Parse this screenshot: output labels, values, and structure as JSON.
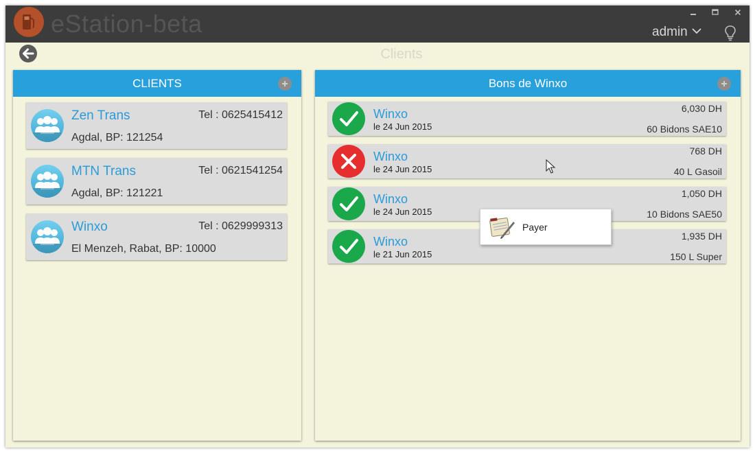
{
  "app": {
    "title": "eStation-beta",
    "user": "admin",
    "icons": {
      "logo": "fuel-pump-icon",
      "user_menu": "chevron-down-icon",
      "help": "lightbulb-icon",
      "back": "back-arrow-icon",
      "add": "add-circle-icon"
    }
  },
  "colors": {
    "accent": "#28a0dc",
    "background": "#f4f4dc",
    "titlebar": "#3c3c3c",
    "ok": "#1aa84a",
    "ko": "#e62e2e",
    "logo": "#b4512a"
  },
  "page": {
    "title": "Clients"
  },
  "clients_panel": {
    "header": "CLIENTS",
    "items": [
      {
        "name": "Zen Trans",
        "tel": "Tel : 0625415412",
        "address": "Agdal, BP: 121254"
      },
      {
        "name": "MTN Trans",
        "tel": "Tel : 0621541254",
        "address": "Agdal, BP: 121221"
      },
      {
        "name": "Winxo",
        "tel": "Tel : 0629999313",
        "address": "El Menzeh, Rabat, BP: 10000"
      }
    ]
  },
  "bons_panel": {
    "header": "Bons de Winxo",
    "items": [
      {
        "status": "paid",
        "status_icon": "check-icon",
        "client": "Winxo",
        "date": "le 24 Jun 2015",
        "amount": "6,030 DH",
        "product": "60 Bidons SAE10"
      },
      {
        "status": "unpaid",
        "status_icon": "close-icon",
        "client": "Winxo",
        "date": "le 24 Jun 2015",
        "amount": "768 DH",
        "product": "40 L Gasoil"
      },
      {
        "status": "paid",
        "status_icon": "check-icon",
        "client": "Winxo",
        "date": "le 24 Jun 2015",
        "amount": "1,050 DH",
        "product": "10 Bidons SAE50"
      },
      {
        "status": "paid",
        "status_icon": "check-icon",
        "client": "Winxo",
        "date": "le 21 Jun 2015",
        "amount": "1,935 DH",
        "product": "150 L Super"
      }
    ]
  },
  "context_menu": {
    "items": [
      {
        "label": "Payer",
        "icon": "notepad-icon"
      }
    ]
  }
}
